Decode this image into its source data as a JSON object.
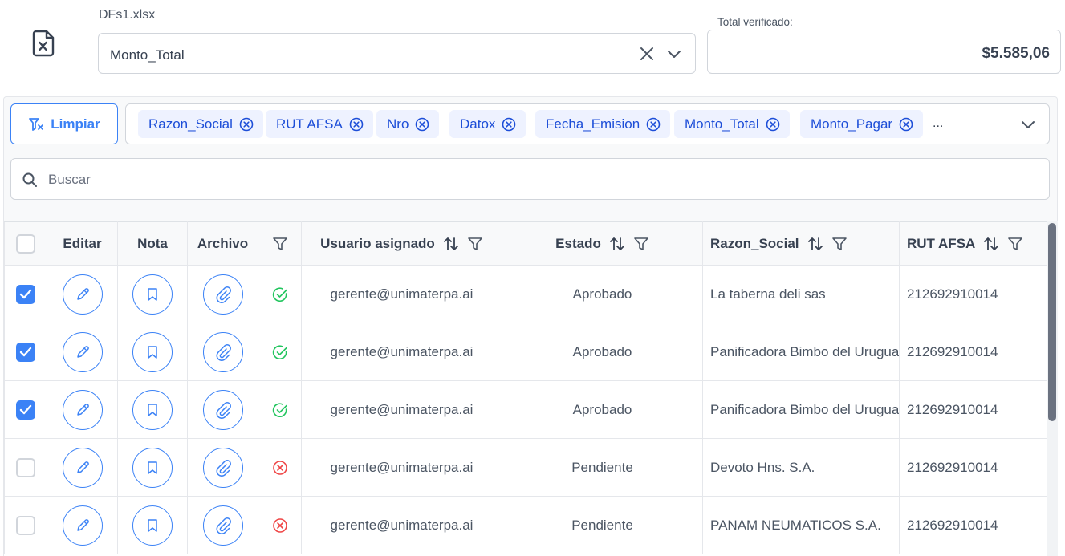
{
  "file": {
    "name": "DFs1.xlsx",
    "icon": "excel-file-icon"
  },
  "column_select": {
    "value": "Monto_Total"
  },
  "total": {
    "label": "Total verificado:",
    "value": "$5.585,06"
  },
  "clear_button": {
    "label": "Limpiar",
    "icon": "filter-clear-icon"
  },
  "visible_columns": {
    "chips": [
      "Razon_Social",
      "RUT AFSA",
      "Nro",
      "Datox",
      "Fecha_Emision",
      "Monto_Total",
      "Monto_Pagar"
    ],
    "more": "..."
  },
  "search": {
    "placeholder": "Buscar"
  },
  "table": {
    "headers": {
      "edit": "Editar",
      "note": "Nota",
      "file": "Archivo",
      "user": "Usuario asignado",
      "status": "Estado",
      "razon": "Razon_Social",
      "rut": "RUT AFSA"
    },
    "rows": [
      {
        "checked": true,
        "verified": "ok",
        "user": "gerente@unimaterpa.ai",
        "status": "Aprobado",
        "razon": "La taberna deli sas",
        "rut": "212692910014"
      },
      {
        "checked": true,
        "verified": "ok",
        "user": "gerente@unimaterpa.ai",
        "status": "Aprobado",
        "razon": "Panificadora Bimbo del Uruguay",
        "rut": "212692910014"
      },
      {
        "checked": true,
        "verified": "ok",
        "user": "gerente@unimaterpa.ai",
        "status": "Aprobado",
        "razon": "Panificadora Bimbo del Uruguay",
        "rut": "212692910014"
      },
      {
        "checked": false,
        "verified": "err",
        "user": "gerente@unimaterpa.ai",
        "status": "Pendiente",
        "razon": "Devoto Hns. S.A.",
        "rut": "212692910014"
      },
      {
        "checked": false,
        "verified": "err",
        "user": "gerente@unimaterpa.ai",
        "status": "Pendiente",
        "razon": "PANAM NEUMATICOS S.A.",
        "rut": "212692910014"
      }
    ]
  },
  "colors": {
    "accent": "#3b82f6",
    "ok": "#22c55e",
    "err": "#ef4444"
  }
}
